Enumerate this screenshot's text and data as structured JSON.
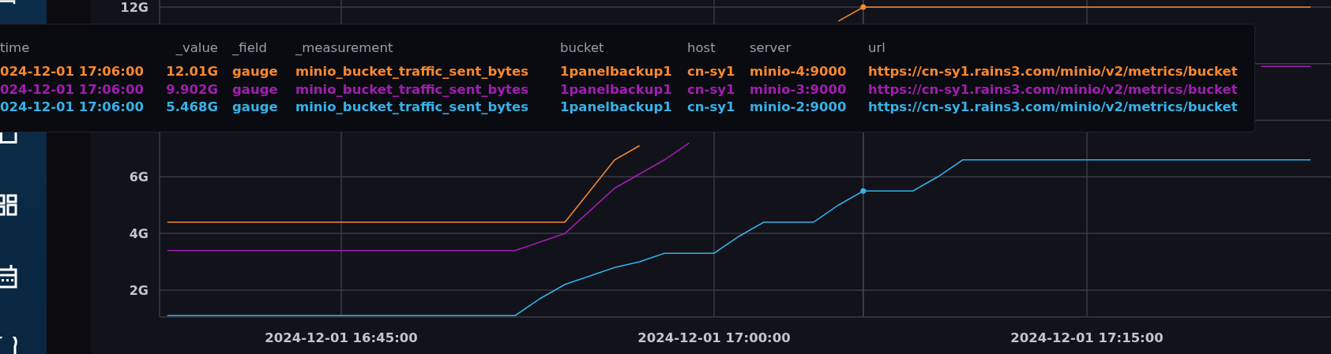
{
  "chart": {
    "chart_data": {
      "type": "line",
      "categories": [
        null,
        null,
        null,
        null,
        null,
        null,
        null,
        "2024-12-01 16:45:00",
        null,
        null,
        null,
        null,
        null,
        null,
        null,
        null,
        null,
        null,
        null,
        null,
        null,
        null,
        "2024-12-01 17:00:00",
        null,
        null,
        null,
        null,
        null,
        null,
        null,
        null,
        null,
        null,
        null,
        null,
        null,
        null,
        "2024-12-01 17:15:00",
        null,
        null,
        null,
        null,
        null,
        null,
        null,
        null,
        null
      ],
      "series": [
        {
          "color": "#f7882f",
          "values": [
            4.4,
            4.4,
            4.4,
            4.4,
            4.4,
            4.4,
            4.4,
            4.4,
            4.4,
            4.4,
            4.4,
            4.4,
            4.4,
            4.4,
            4.4,
            4.4,
            4.4,
            5.5,
            6.6,
            7.1,
            null,
            null,
            null,
            null,
            null,
            null,
            null,
            11.5,
            12.0,
            12.0,
            12.0,
            12.0,
            12.0,
            12.0,
            12.0,
            12.0,
            12.0,
            12.0,
            12.0,
            12.0,
            12.0,
            12.0,
            12.0,
            12.0,
            12.0,
            12.0,
            12.0
          ]
        },
        {
          "color": "#a31db3",
          "values": [
            3.4,
            3.4,
            3.4,
            3.4,
            3.4,
            3.4,
            3.4,
            3.4,
            3.4,
            3.4,
            3.4,
            3.4,
            3.4,
            3.4,
            3.4,
            3.7,
            4.0,
            4.8,
            5.6,
            6.1,
            6.6,
            7.2,
            null,
            null,
            null,
            null,
            null,
            null,
            null,
            null,
            null,
            null,
            null,
            null,
            null,
            null,
            null,
            null,
            null,
            null,
            null,
            null,
            null,
            null,
            9.9,
            9.9,
            9.9
          ]
        },
        {
          "color": "#36b2e8",
          "values": [
            1.1,
            1.1,
            1.1,
            1.1,
            1.1,
            1.1,
            1.1,
            1.1,
            1.1,
            1.1,
            1.1,
            1.1,
            1.1,
            1.1,
            1.1,
            1.7,
            2.2,
            2.5,
            2.8,
            3.0,
            3.3,
            3.3,
            3.3,
            3.9,
            4.4,
            4.4,
            4.4,
            5.0,
            5.5,
            5.5,
            5.5,
            6.0,
            6.6,
            6.6,
            6.6,
            6.6,
            6.6,
            6.6,
            6.6,
            6.6,
            6.6,
            6.6,
            6.6,
            6.6,
            6.6,
            6.6,
            6.6
          ]
        }
      ],
      "ylim": [
        1.05,
        12.25
      ],
      "grid": true,
      "yticks": [
        {
          "value": 2,
          "label": "2G"
        },
        {
          "value": 4,
          "label": "4G"
        },
        {
          "value": 6,
          "label": "6G"
        },
        {
          "value": 12,
          "label": "12G"
        }
      ]
    }
  },
  "tooltip": {
    "columns": [
      {
        "label": "time",
        "kind": "text"
      },
      {
        "label": "_value",
        "kind": "number"
      },
      {
        "label": "_field",
        "kind": "text"
      },
      {
        "label": "_measurement",
        "kind": "text"
      },
      {
        "label": "bucket",
        "kind": "text"
      },
      {
        "label": "host",
        "kind": "text"
      },
      {
        "label": "server",
        "kind": "text"
      },
      {
        "label": "url",
        "kind": "text"
      }
    ],
    "rows": [
      {
        "color": "#f7882f",
        "cells": [
          "024-12-01 17:06:00",
          "12.01G",
          "gauge",
          "minio_bucket_traffic_sent_bytes",
          "1panelbackup1",
          "cn-sy1",
          "minio-4:9000",
          "https://cn-sy1.rains3.com/minio/v2/metrics/bucket"
        ]
      },
      {
        "color": "#a31db3",
        "cells": [
          "024-12-01 17:06:00",
          "9.902G",
          "gauge",
          "minio_bucket_traffic_sent_bytes",
          "1panelbackup1",
          "cn-sy1",
          "minio-3:9000",
          "https://cn-sy1.rains3.com/minio/v2/metrics/bucket"
        ]
      },
      {
        "color": "#36b2e8",
        "cells": [
          "024-12-01 17:06:00",
          "5.468G",
          "gauge",
          "minio_bucket_traffic_sent_bytes",
          "1panelbackup1",
          "cn-sy1",
          "minio-2:9000",
          "https://cn-sy1.rains3.com/minio/v2/metrics/bucket"
        ]
      }
    ]
  }
}
